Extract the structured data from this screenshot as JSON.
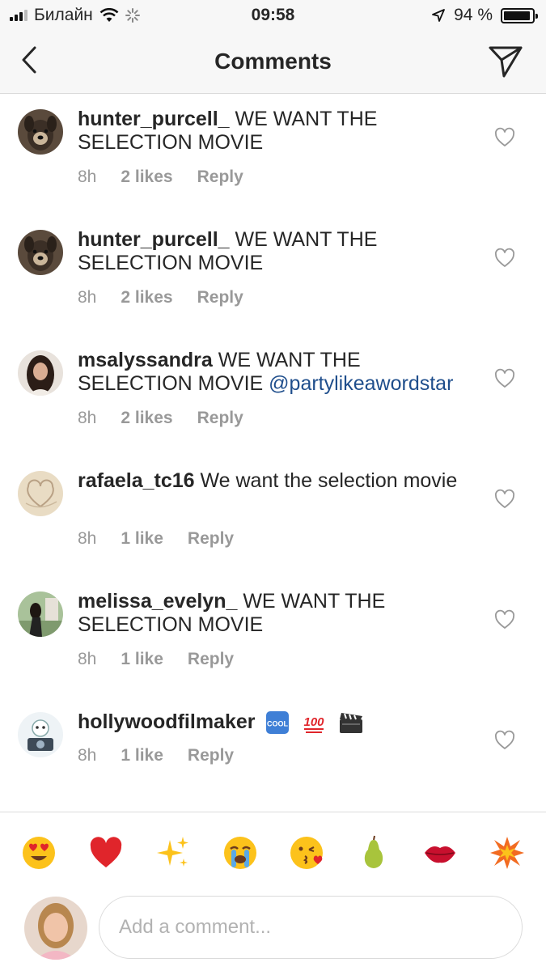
{
  "status_bar": {
    "carrier": "Билайн",
    "time": "09:58",
    "battery": "94 %",
    "battery_level": 0.94
  },
  "header": {
    "title": "Comments",
    "back_icon": "chevron-left-icon",
    "send_icon": "paper-plane-icon"
  },
  "comments": [
    {
      "username": "hunter_purcell_",
      "text": " WE WANT THE SELECTION MOVIE",
      "mention": "",
      "time": "8h",
      "likes": "2 likes",
      "reply": "Reply"
    },
    {
      "username": "hunter_purcell_",
      "text": " WE WANT THE SELECTION MOVIE",
      "mention": "",
      "time": "8h",
      "likes": "2 likes",
      "reply": "Reply"
    },
    {
      "username": "msalyssandra",
      "text": " WE WANT THE SELECTION MOVIE ",
      "mention": "@partylikeawordstar",
      "time": "8h",
      "likes": "2 likes",
      "reply": "Reply"
    },
    {
      "username": "rafaela_tc16",
      "text": " We want the selection movie",
      "mention": "",
      "time": "8h",
      "likes": "1 like",
      "reply": "Reply"
    },
    {
      "username": "melissa_evelyn_",
      "text": " WE WANT THE SELECTION MOVIE",
      "mention": "",
      "time": "8h",
      "likes": "1 like",
      "reply": "Reply"
    },
    {
      "username": "hollywoodfilmaker",
      "text": "",
      "mention": "",
      "time": "8h",
      "likes": "1 like",
      "reply": "Reply",
      "emojis": [
        "cool-button",
        "hundred-points",
        "clapper-board"
      ]
    }
  ],
  "emoji_bar": [
    "heart-eyes",
    "red-heart",
    "sparkles",
    "crying-face",
    "kissing-face",
    "pear",
    "lips",
    "collision"
  ],
  "input": {
    "placeholder": "Add a comment..."
  }
}
